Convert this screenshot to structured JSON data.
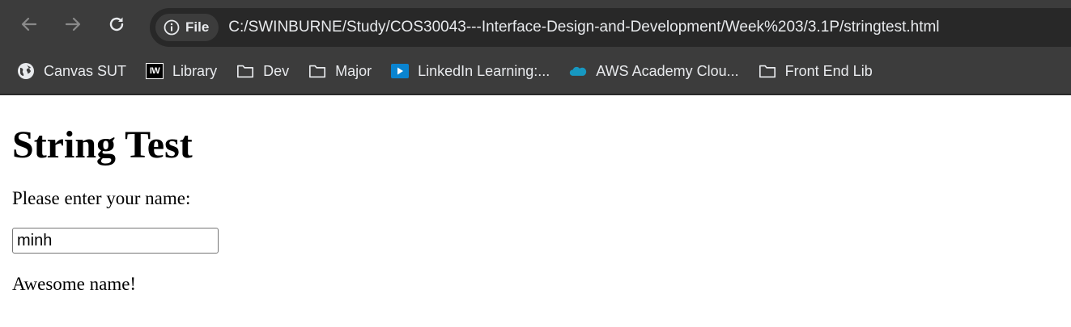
{
  "toolbar": {
    "back_icon": "arrow-left-icon",
    "forward_icon": "arrow-right-icon",
    "reload_icon": "reload-icon",
    "site_chip_label": "File",
    "url": "C:/SWINBURNE/Study/COS30043---Interface-Design-and-Development/Week%203/3.1P/stringtest.html"
  },
  "bookmarks": [
    {
      "label": "Canvas SUT",
      "icon": "globe-icon"
    },
    {
      "label": "Library",
      "icon": "iw-logo-icon"
    },
    {
      "label": "Dev",
      "icon": "folder-icon"
    },
    {
      "label": "Major",
      "icon": "folder-icon"
    },
    {
      "label": "LinkedIn Learning:...",
      "icon": "linkedin-learning-icon"
    },
    {
      "label": "AWS Academy Clou...",
      "icon": "salesforce-cloud-icon"
    },
    {
      "label": "Front End Lib",
      "icon": "folder-icon"
    }
  ],
  "page": {
    "title": "String Test",
    "prompt": "Please enter your name:",
    "name_value": "minh",
    "result": "Awesome name!"
  },
  "colors": {
    "chrome_bg": "#3c3c3c",
    "omnibox_bg": "#282828",
    "chrome_text": "#e8eaed",
    "page_bg": "#ffffff"
  }
}
